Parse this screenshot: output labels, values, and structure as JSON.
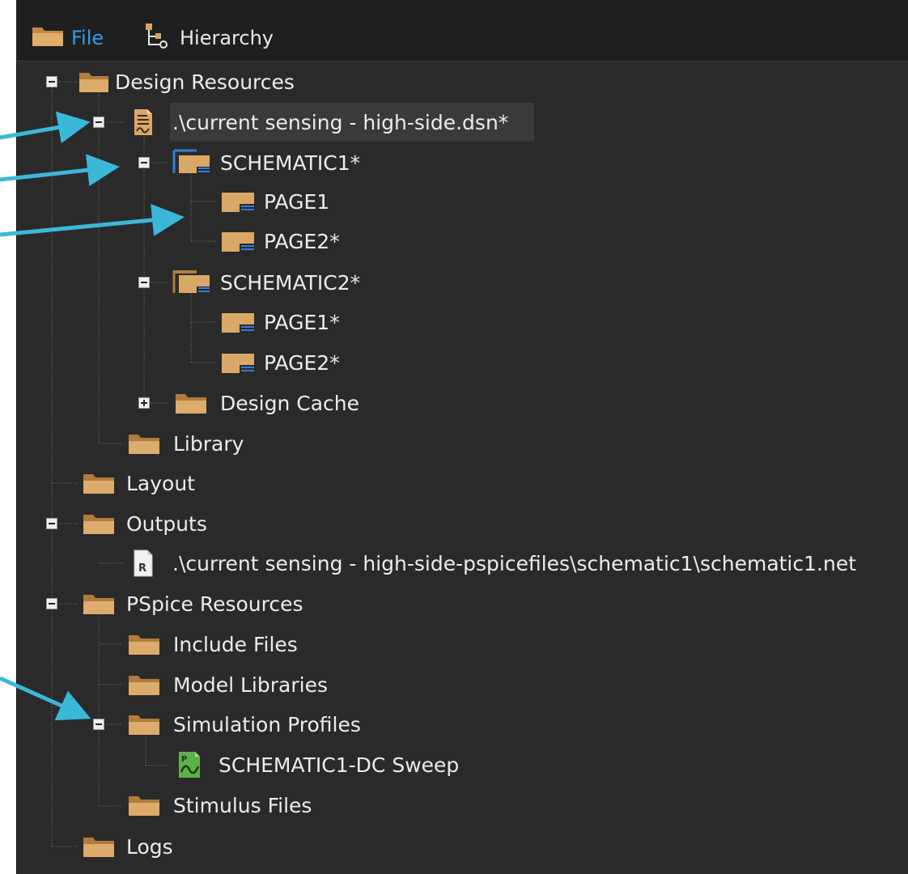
{
  "tabs": [
    {
      "label": "File",
      "icon": "folder-icon",
      "active": true
    },
    {
      "label": "Hierarchy",
      "icon": "hierarchy-icon",
      "active": false
    }
  ],
  "tree": {
    "design_resources": "Design Resources",
    "design_file": ".\\current sensing - high-side.dsn*",
    "schematic1": "SCHEMATIC1*",
    "s1_page1": "PAGE1",
    "s1_page2": "PAGE2*",
    "schematic2": "SCHEMATIC2*",
    "s2_page1": "PAGE1*",
    "s2_page2": "PAGE2*",
    "design_cache": "Design Cache",
    "library": "Library",
    "layout": "Layout",
    "outputs": "Outputs",
    "netlist": ".\\current sensing - high-side-pspicefiles\\schematic1\\schematic1.net",
    "pspice_resources": "PSpice Resources",
    "include_files": "Include Files",
    "model_libraries": "Model Libraries",
    "simulation_profiles": "Simulation Profiles",
    "sim_profile_item": "SCHEMATIC1-DC Sweep",
    "stimulus_files": "Stimulus Files",
    "logs": "Logs"
  },
  "colors": {
    "panel_bg": "#2a2a2a",
    "active_tab": "#2f9ef0",
    "arrow": "#3bb8d8",
    "folder": "#d6a463",
    "page_accent": "#2f80d6",
    "sim_green": "#5fb04a"
  },
  "icons": {
    "folder": "folder-icon",
    "design": "design-file-icon",
    "schematic": "schematic-icon",
    "page": "page-icon",
    "netlist": "netlist-file-icon",
    "sim_profile": "simulation-profile-icon",
    "hierarchy": "hierarchy-icon"
  }
}
